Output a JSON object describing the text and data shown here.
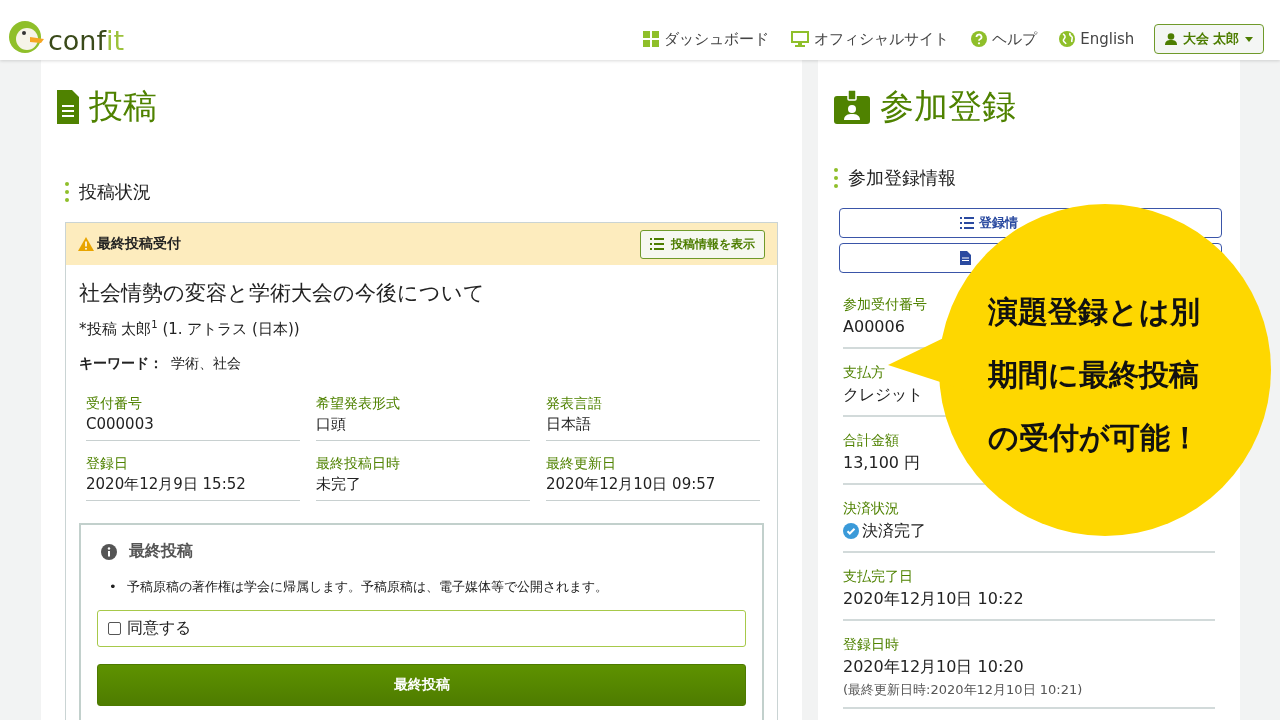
{
  "header": {
    "logo": {
      "text_dark": "conf",
      "text_light": "it"
    },
    "nav": [
      {
        "kind": "dashboard",
        "label": "ダッシュボード"
      },
      {
        "kind": "monitor",
        "label": "オフィシャルサイト"
      },
      {
        "kind": "help",
        "label": "ヘルプ"
      },
      {
        "kind": "globe",
        "label": "English"
      }
    ],
    "user_menu": {
      "label": "大会 太郎"
    }
  },
  "submission": {
    "title": "投稿",
    "section": "投稿状況",
    "panel": {
      "status": "最終投稿受付",
      "show_button": "投稿情報を表示",
      "paper_title": "社会情勢の変容と学術大会の今後について",
      "author": {
        "name": "*投稿 太郎",
        "mark": "1",
        "affiliation": "(1. アトラス (日本))"
      },
      "keywords": {
        "label": "キーワード：",
        "value": "学術、社会"
      },
      "fields": [
        {
          "label": "受付番号",
          "value": "C000003"
        },
        {
          "label": "希望発表形式",
          "value": "口頭"
        },
        {
          "label": "発表言語",
          "value": "日本語"
        },
        {
          "label": "登録日",
          "value": "2020年12月9日 15:52"
        },
        {
          "label": "最終投稿日時",
          "value": "未完了"
        },
        {
          "label": "最終更新日",
          "value": "2020年12月10日 09:57"
        }
      ],
      "final": {
        "title": "最終投稿",
        "notes": [
          {
            "marker": "•",
            "text": "予稿原稿の著作権は学会に帰属します。予稿原稿は、電子媒体等で公開されます。"
          }
        ],
        "agree": {
          "label": "同意する",
          "checked": false
        },
        "submit": "最終投稿"
      }
    }
  },
  "registration": {
    "title": "参加登録",
    "section": "参加登録情報",
    "buttons": [
      {
        "kind": "list",
        "label": "登録情"
      },
      {
        "kind": "document"
      }
    ],
    "fields": [
      {
        "label": "参加受付番号",
        "value": "A00006"
      },
      {
        "label": "支払方",
        "value": "クレジット"
      },
      {
        "label": "合計金額",
        "value": "13,100 円"
      },
      {
        "label": "決済状況",
        "value": "決済完了",
        "kind": "paid"
      },
      {
        "label": "支払完了日",
        "value": "2020年12月10日 10:22"
      },
      {
        "label": "登録日時",
        "value": "2020年12月10日 10:20",
        "note": "(最終更新日時:2020年12月10日 10:21)"
      }
    ]
  },
  "callout": {
    "lines": [
      "演題登録とは別",
      "期間に最終投稿",
      "の受付が可能！"
    ]
  }
}
